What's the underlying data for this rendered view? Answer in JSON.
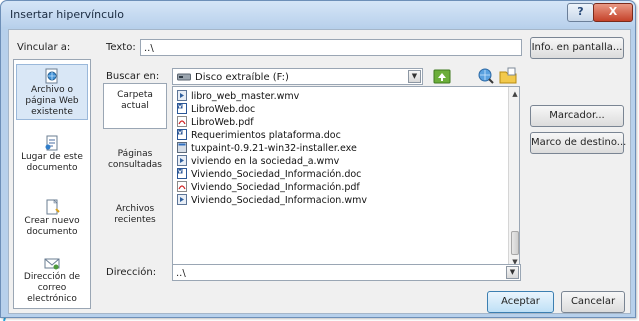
{
  "window": {
    "title": "Insertar hipervínculo",
    "help_label": "?",
    "close_label": "X"
  },
  "link_to": {
    "label": "Vincular a:",
    "items": [
      {
        "label": "Archivo o página Web existente",
        "icon": "globe-page-icon",
        "selected": true
      },
      {
        "label": "Lugar de este documento",
        "icon": "document-place-icon",
        "selected": false
      },
      {
        "label": "Crear nuevo documento",
        "icon": "new-document-icon",
        "selected": false
      },
      {
        "label": "Dirección de correo electrónico",
        "icon": "email-icon",
        "selected": false
      }
    ]
  },
  "text_field": {
    "label": "Texto:",
    "value": "..\\"
  },
  "screen_tip_button": "Info. en pantalla...",
  "look_in": {
    "label": "Buscar en:",
    "value": "Disco extraíble (F:)",
    "drive_icon": "removable-drive-icon"
  },
  "toolbar_icons": [
    "up-folder-icon",
    "browse-web-icon",
    "browse-file-icon"
  ],
  "nav": {
    "items": [
      {
        "label": "Carpeta actual",
        "selected": true
      },
      {
        "label": "Páginas consultadas",
        "selected": false
      },
      {
        "label": "Archivos recientes",
        "selected": false
      }
    ]
  },
  "files": [
    {
      "name": "libro_web_master.wmv",
      "icon": "video-file-icon"
    },
    {
      "name": "LibroWeb.doc",
      "icon": "word-file-icon"
    },
    {
      "name": "LibroWeb.pdf",
      "icon": "pdf-file-icon"
    },
    {
      "name": "Requerimientos plataforma.doc",
      "icon": "word-file-icon"
    },
    {
      "name": "tuxpaint-0.9.21-win32-installer.exe",
      "icon": "exe-file-icon"
    },
    {
      "name": "viviendo en la sociedad_a.wmv",
      "icon": "video-file-icon"
    },
    {
      "name": "Viviendo_Sociedad_Información.doc",
      "icon": "word-file-icon"
    },
    {
      "name": "Viviendo_Sociedad_Información.pdf",
      "icon": "pdf-file-icon"
    },
    {
      "name": "Viviendo_Sociedad_Informacion.wmv",
      "icon": "video-file-icon"
    }
  ],
  "right_buttons": {
    "bookmark": "Marcador...",
    "target_frame": "Marco de destino..."
  },
  "address": {
    "label": "Dirección:",
    "value": "..\\"
  },
  "footer": {
    "ok": "Aceptar",
    "cancel": "Cancelar"
  },
  "colors": {
    "window_frame": "#b7d0eb",
    "client_bg": "#f0f0f0",
    "close_red": "#c5422a",
    "selection": "#d9e7f6",
    "background_arcs": "#29a9e0"
  }
}
